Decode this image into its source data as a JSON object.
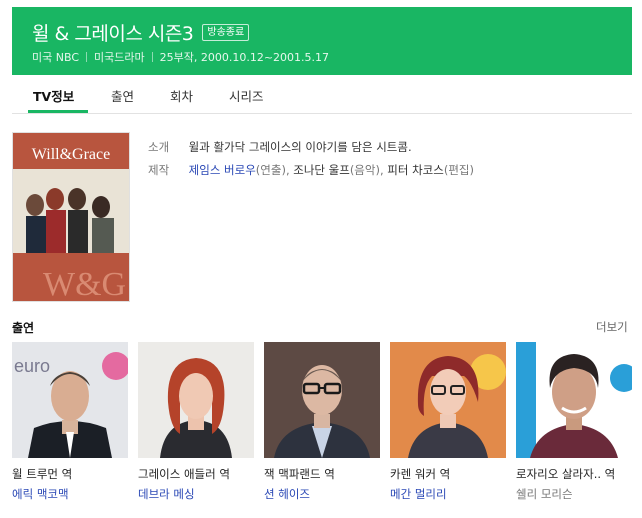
{
  "header": {
    "title": "윌 & 그레이스 시즌3",
    "badge": "방송종료",
    "meta": [
      "미국 NBC",
      "미국드라마",
      "25부작, 2000.10.12~2001.5.17"
    ]
  },
  "tabs": [
    {
      "label": "TV정보",
      "active": true
    },
    {
      "label": "출연",
      "active": false
    },
    {
      "label": "회차",
      "active": false
    },
    {
      "label": "시리즈",
      "active": false
    }
  ],
  "poster": {
    "title": "Will&Grace",
    "logo": "W&G",
    "icon": "poster-image"
  },
  "info": {
    "synopsis_label": "소개",
    "synopsis": "윌과 활가닥 그레이스의 이야기를 담은 시트콤.",
    "staff_label": "제작",
    "staff": [
      {
        "name": "제임스 버로우",
        "role": "(연출)"
      },
      {
        "name": "조나단 울프",
        "role": "(음악)"
      },
      {
        "name": "피터 차코스",
        "role": "(편집)"
      }
    ]
  },
  "cast": {
    "heading": "출연",
    "more": "더보기",
    "members": [
      {
        "role": "윌 트루먼 역",
        "actor": "에릭 맥코맥",
        "linked": true
      },
      {
        "role": "그레이스 애들러 역",
        "actor": "데브라 메싱",
        "linked": true
      },
      {
        "role": "잭 맥파랜드 역",
        "actor": "션 헤이즈",
        "linked": true
      },
      {
        "role": "카렌 워커 역",
        "actor": "메간 멀리리",
        "linked": true
      },
      {
        "role": "로자리오 살라자.. 역",
        "actor": "쉘리 모리슨",
        "linked": false
      }
    ]
  },
  "colors": {
    "accent": "#19b663",
    "link": "#2a48b5"
  }
}
